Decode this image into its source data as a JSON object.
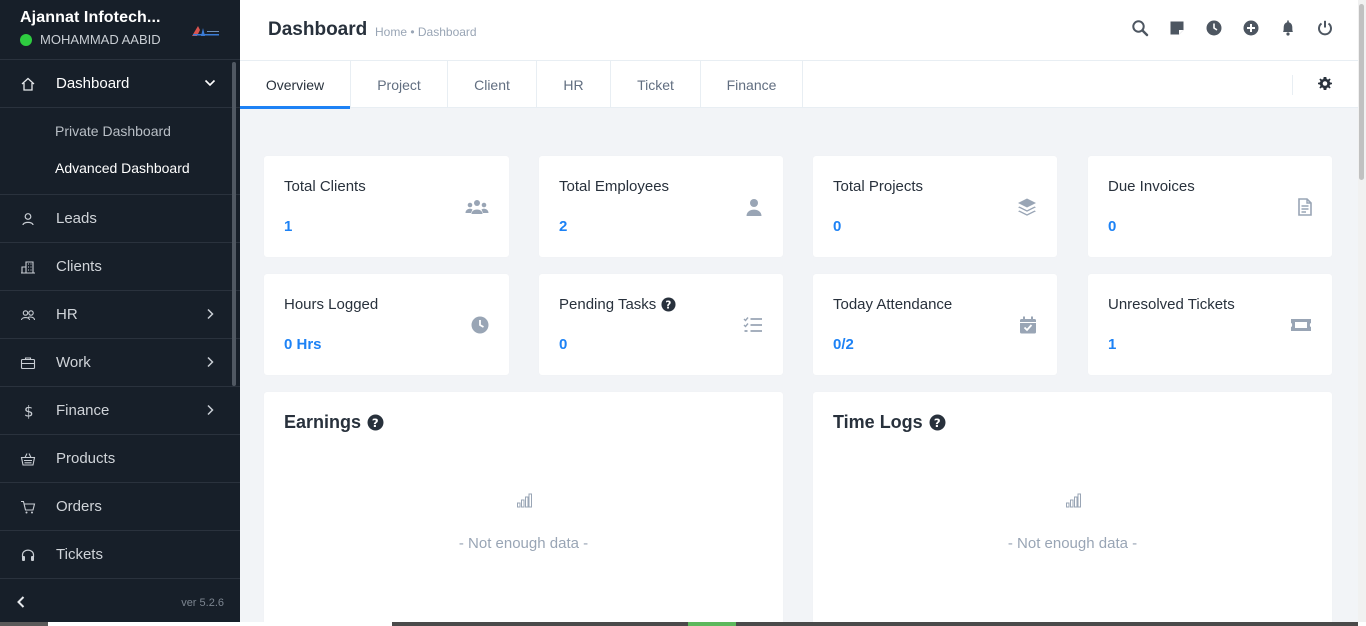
{
  "sidebar": {
    "company": "Ajannat Infotech...",
    "user": "MOHAMMAD AABID",
    "items": [
      {
        "label": "Dashboard",
        "icon": "home-icon"
      },
      {
        "label": "Leads",
        "icon": "user-icon"
      },
      {
        "label": "Clients",
        "icon": "building-icon"
      },
      {
        "label": "HR",
        "icon": "people-icon"
      },
      {
        "label": "Work",
        "icon": "briefcase-icon"
      },
      {
        "label": "Finance",
        "icon": "dollar-icon"
      },
      {
        "label": "Products",
        "icon": "basket-icon"
      },
      {
        "label": "Orders",
        "icon": "cart-icon"
      },
      {
        "label": "Tickets",
        "icon": "headset-icon"
      }
    ],
    "dashboard_sub": [
      "Private Dashboard",
      "Advanced Dashboard"
    ],
    "version": "ver 5.2.6"
  },
  "header": {
    "title": "Dashboard",
    "breadcrumb": "Home • Dashboard"
  },
  "tabs": [
    "Overview",
    "Project",
    "Client",
    "HR",
    "Ticket",
    "Finance"
  ],
  "stats": [
    {
      "label": "Total Clients",
      "value": "1",
      "icon": "users-icon"
    },
    {
      "label": "Total Employees",
      "value": "2",
      "icon": "person-icon"
    },
    {
      "label": "Total Projects",
      "value": "0",
      "icon": "layers-icon"
    },
    {
      "label": "Due Invoices",
      "value": "0",
      "icon": "invoice-icon"
    },
    {
      "label": "Hours Logged",
      "value": "0 Hrs",
      "icon": "clock-icon"
    },
    {
      "label": "Pending Tasks",
      "value": "0",
      "icon": "tasks-icon"
    },
    {
      "label": "Today Attendance",
      "value": "0/2",
      "icon": "calendar-check-icon"
    },
    {
      "label": "Unresolved Tickets",
      "value": "1",
      "icon": "ticket-icon"
    }
  ],
  "panels": [
    {
      "title": "Earnings",
      "empty": "- Not enough data -"
    },
    {
      "title": "Time Logs",
      "empty": "- Not enough data -"
    }
  ],
  "colors": {
    "sidebar_bg": "#171f29",
    "accent": "#1d82f5",
    "online": "#2ecc40"
  }
}
